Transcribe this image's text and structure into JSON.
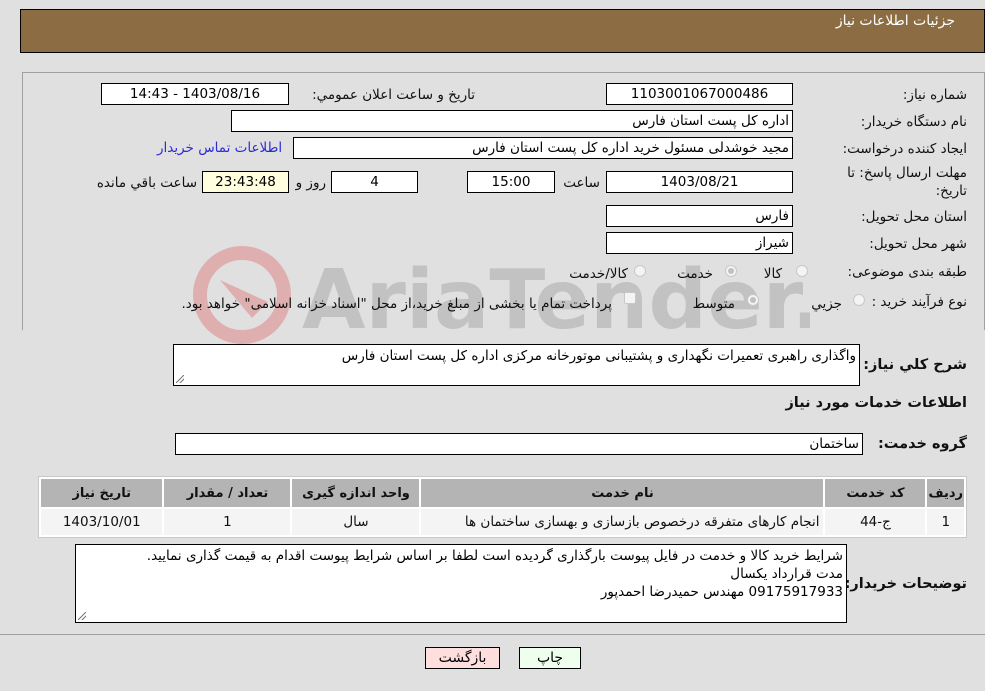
{
  "header": {
    "title": "جزئیات اطلاعات نیاز"
  },
  "form": {
    "need_number": {
      "label": "شماره نیاز:",
      "value": "1103001067000486"
    },
    "announce_datetime": {
      "label": "تاریخ و ساعت اعلان عمومي:",
      "value": "1403/08/16 - 14:43"
    },
    "buyer_org": {
      "label": "نام دستگاه خریدار:",
      "value": "اداره کل پست استان فارس"
    },
    "requester": {
      "label": "ایجاد کننده درخواست:",
      "value": "مجید خوشدلی مسئول خرید اداره کل پست استان فارس"
    },
    "buyer_contact_link": "اطلاعات تماس خریدار",
    "deadline": {
      "label_line1": "مهلت ارسال پاسخ: تا",
      "label_line2": "تاریخ:",
      "date": "1403/08/21",
      "time_label": "ساعت",
      "time": "15:00",
      "days": "4",
      "days_label": "روز و",
      "remaining_time": "23:43:48",
      "remaining_label": "ساعت باقي مانده"
    },
    "delivery_province": {
      "label": "استان محل تحویل:",
      "value": "فارس"
    },
    "delivery_city": {
      "label": "شهر محل تحویل:",
      "value": "شیراز"
    },
    "category": {
      "label": "طبقه بندی موضوعی:",
      "options": [
        "کالا",
        "خدمت",
        "کالا/خدمت"
      ],
      "selected": "خدمت"
    },
    "purchase_process": {
      "label": "نوع فرآیند خرید :",
      "options": [
        "جزيي",
        "متوسط"
      ],
      "selected": "متوسط",
      "treasury_note": "پرداخت تمام یا بخشی از مبلغ خرید،از محل \"اسناد خزانه اسلامی\" خواهد بود."
    },
    "general_description": {
      "label": "شرح کلي نیاز:",
      "value": "واگذاری راهبری تعمیرات نگهداری و پشتیبانی موتورخانه مرکزی اداره کل پست استان فارس"
    }
  },
  "services_section": {
    "title": "اطلاعات خدمات مورد نیاز",
    "service_group": {
      "label": "گروه خدمت:",
      "value": "ساختمان"
    },
    "table": {
      "headers": [
        "ردیف",
        "کد خدمت",
        "نام خدمت",
        "واحد اندازه گیری",
        "تعداد / مقدار",
        "تاریخ نیاز"
      ],
      "rows": [
        [
          "1",
          "ج-44",
          "انجام کارهای متفرقه درخصوص بازسازی و بهسازی ساختمان ها",
          "سال",
          "1",
          "1403/10/01"
        ]
      ]
    }
  },
  "buyer_notes": {
    "label": "توضیحات خریدار:",
    "lines": [
      "شرایط خرید کالا و خدمت در فایل پیوست بارگذاری گردیده است لطفا بر اساس شرایط پیوست اقدام به قیمت گذاری نمایید.",
      "مدت قرارداد یکسال",
      "09175917933 مهندس حمیدرضا احمدپور"
    ]
  },
  "buttons": {
    "print": "چاپ",
    "back": "بازگشت"
  },
  "watermark": {
    "text": "AriaTender.neT"
  }
}
